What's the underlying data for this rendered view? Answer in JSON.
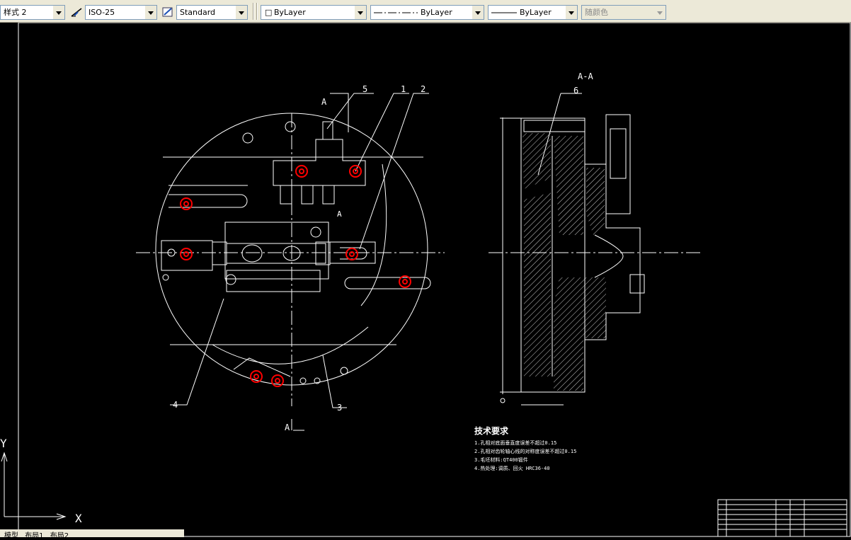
{
  "toolbar": {
    "text_style_label": "样式 2",
    "dim_style": "ISO-25",
    "table_style": "Standard",
    "layer": "ByLayer",
    "linetype": "ByLayer",
    "lineweight": "ByLayer",
    "plot_style": "随颜色"
  },
  "drawing": {
    "section_label": "A-A",
    "callouts": [
      "1",
      "2",
      "3",
      "4",
      "5",
      "6"
    ],
    "cut_label_top": "A",
    "cut_label_mid": "A",
    "cut_label_bottom": "A",
    "requirements_title": "技术要求",
    "requirements": [
      "1.孔相对底面垂直度误差不超过0.15",
      "2.孔相对齿轮轴心线的对称度误差不超过0.15",
      "3.毛坯材料:QT400锻件",
      "4.热处理:调质、回火 HRC36-40"
    ]
  },
  "ucs": {
    "y": "Y",
    "x": "X"
  },
  "tabs": {
    "model": "模型",
    "layout1": "布局1",
    "layout2": "布局2"
  },
  "colors": {
    "toolbar_bg": "#ece9d8",
    "canvas_bg": "#000000",
    "highlight": "#ff0000",
    "line": "#ffffff"
  }
}
